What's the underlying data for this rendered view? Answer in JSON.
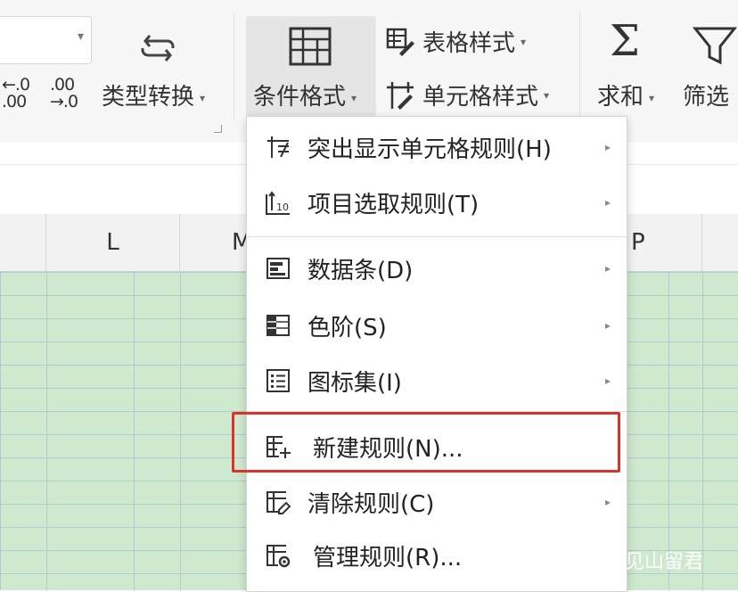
{
  "ribbon": {
    "number_combo_value": "",
    "increase_decimal": "←.0\n.00",
    "decrease_decimal": ".00\n→.0",
    "type_convert_label": "类型转换",
    "conditional_format_label": "条件格式",
    "table_style_label": "表格样式",
    "cell_style_label": "单元格样式",
    "sum_label": "求和",
    "filter_label": "筛选"
  },
  "columns": [
    "",
    "L",
    "M",
    "",
    "",
    "P",
    ""
  ],
  "menu": {
    "items": [
      {
        "label": "突出显示单元格规则(H)",
        "icon": "highlight-rules-icon",
        "has_submenu": true
      },
      {
        "label": "项目选取规则(T)",
        "icon": "top-bottom-rules-icon",
        "has_submenu": true
      },
      {
        "label": "数据条(D)",
        "icon": "data-bars-icon",
        "has_submenu": true
      },
      {
        "label": "色阶(S)",
        "icon": "color-scales-icon",
        "has_submenu": true
      },
      {
        "label": "图标集(I)",
        "icon": "icon-sets-icon",
        "has_submenu": true
      },
      {
        "label": "新建规则(N)...",
        "icon": "new-rule-icon",
        "has_submenu": false
      },
      {
        "label": "清除规则(C)",
        "icon": "clear-rules-icon",
        "has_submenu": true
      },
      {
        "label": "管理规则(R)...",
        "icon": "manage-rules-icon",
        "has_submenu": false
      }
    ]
  },
  "watermark": "知乎 @见山留君",
  "colors": {
    "grid_fill": "#cfe9cf",
    "highlight_border": "#d9342b",
    "ribbon_bg": "#f7f7f7",
    "active_button_bg": "#e5e5e5"
  }
}
